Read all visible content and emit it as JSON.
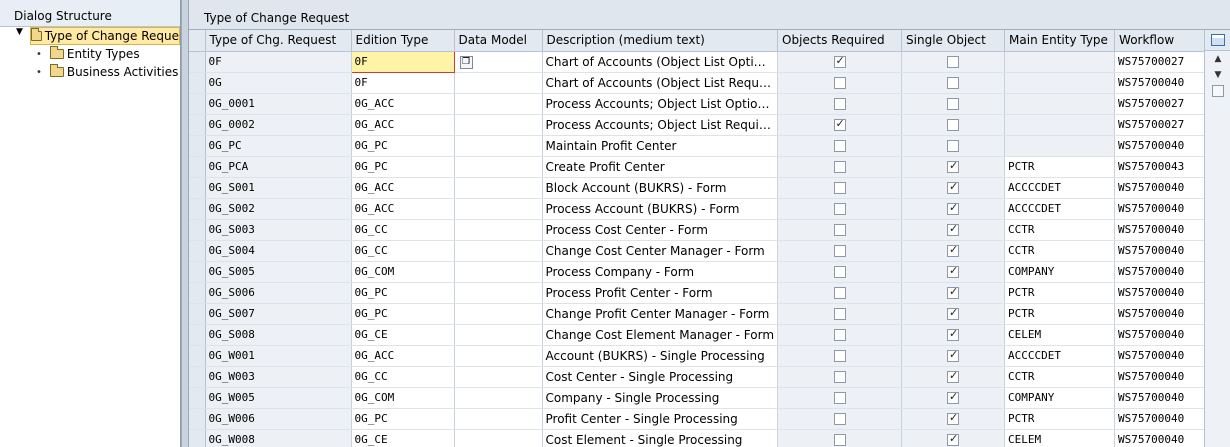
{
  "left_panel": {
    "header": "Dialog Structure",
    "tree": [
      {
        "label": "Type of Change Reque",
        "selected": true,
        "expanded": true
      },
      {
        "label": "Entity Types",
        "selected": false
      },
      {
        "label": "Business Activities",
        "selected": false
      }
    ]
  },
  "main": {
    "title": "Type of Change Request",
    "columns": [
      "Type of Chg. Request",
      "Edition Type",
      "Data Model",
      "Description (medium text)",
      "Objects Required",
      "Single Object",
      "Main Entity Type",
      "Workflow"
    ],
    "rows": [
      {
        "type": "0F",
        "edition": "0F",
        "model": "",
        "desc": "Chart of Accounts (Object List Opti…",
        "objreq": true,
        "single": false,
        "entity": "",
        "workflow": "WS75700027"
      },
      {
        "type": "0G",
        "edition": "0F",
        "model": "",
        "desc": "Chart of Accounts (Object List Requ…",
        "objreq": false,
        "single": false,
        "entity": "",
        "workflow": "WS75700040"
      },
      {
        "type": "0G_0001",
        "edition": "0G_ACC",
        "model": "",
        "desc": "Process Accounts; Object List Optio…",
        "objreq": false,
        "single": false,
        "entity": "",
        "workflow": "WS75700027"
      },
      {
        "type": "0G_0002",
        "edition": "0G_ACC",
        "model": "",
        "desc": "Process Accounts; Object List Requi…",
        "objreq": true,
        "single": false,
        "entity": "",
        "workflow": "WS75700027"
      },
      {
        "type": "0G_PC",
        "edition": "0G_PC",
        "model": "",
        "desc": "Maintain Profit Center",
        "objreq": false,
        "single": false,
        "entity": "",
        "workflow": "WS75700040"
      },
      {
        "type": "0G_PCA",
        "edition": "0G_PC",
        "model": "",
        "desc": "Create Profit Center",
        "objreq": false,
        "single": true,
        "entity": "PCTR",
        "workflow": "WS75700043"
      },
      {
        "type": "0G_S001",
        "edition": "0G_ACC",
        "model": "",
        "desc": "Block Account (BUKRS) - Form",
        "objreq": false,
        "single": true,
        "entity": "ACCCCDET",
        "workflow": "WS75700040"
      },
      {
        "type": "0G_S002",
        "edition": "0G_ACC",
        "model": "",
        "desc": "Process Account (BUKRS) - Form",
        "objreq": false,
        "single": true,
        "entity": "ACCCCDET",
        "workflow": "WS75700040"
      },
      {
        "type": "0G_S003",
        "edition": "0G_CC",
        "model": "",
        "desc": "Process Cost Center - Form",
        "objreq": false,
        "single": true,
        "entity": "CCTR",
        "workflow": "WS75700040"
      },
      {
        "type": "0G_S004",
        "edition": "0G_CC",
        "model": "",
        "desc": "Change Cost Center Manager - Form",
        "objreq": false,
        "single": true,
        "entity": "CCTR",
        "workflow": "WS75700040"
      },
      {
        "type": "0G_S005",
        "edition": "0G_COM",
        "model": "",
        "desc": "Process Company - Form",
        "objreq": false,
        "single": true,
        "entity": "COMPANY",
        "workflow": "WS75700040"
      },
      {
        "type": "0G_S006",
        "edition": "0G_PC",
        "model": "",
        "desc": "Process Profit Center - Form",
        "objreq": false,
        "single": true,
        "entity": "PCTR",
        "workflow": "WS75700040"
      },
      {
        "type": "0G_S007",
        "edition": "0G_PC",
        "model": "",
        "desc": "Change Profit Center Manager - Form",
        "objreq": false,
        "single": true,
        "entity": "PCTR",
        "workflow": "WS75700040"
      },
      {
        "type": "0G_S008",
        "edition": "0G_CE",
        "model": "",
        "desc": "Change Cost Element Manager - Form",
        "objreq": false,
        "single": true,
        "entity": "CELEM",
        "workflow": "WS75700040"
      },
      {
        "type": "0G_W001",
        "edition": "0G_ACC",
        "model": "",
        "desc": "Account (BUKRS) - Single Processing",
        "objreq": false,
        "single": true,
        "entity": "ACCCCDET",
        "workflow": "WS75700040"
      },
      {
        "type": "0G_W003",
        "edition": "0G_CC",
        "model": "",
        "desc": "Cost Center - Single Processing",
        "objreq": false,
        "single": true,
        "entity": "CCTR",
        "workflow": "WS75700040"
      },
      {
        "type": "0G_W005",
        "edition": "0G_COM",
        "model": "",
        "desc": "Company - Single Processing",
        "objreq": false,
        "single": true,
        "entity": "COMPANY",
        "workflow": "WS75700040"
      },
      {
        "type": "0G_W006",
        "edition": "0G_PC",
        "model": "",
        "desc": "Profit Center - Single Processing",
        "objreq": false,
        "single": true,
        "entity": "PCTR",
        "workflow": "WS75700040"
      },
      {
        "type": "0G_W008",
        "edition": "0G_CE",
        "model": "",
        "desc": "Cost Element - Single Processing",
        "objreq": false,
        "single": true,
        "entity": "CELEM",
        "workflow": "WS75700040"
      }
    ]
  },
  "icons": {
    "tree_folder": "folder-icon",
    "f4_help": "value-help-icon",
    "table_settings": "table-settings-icon"
  }
}
